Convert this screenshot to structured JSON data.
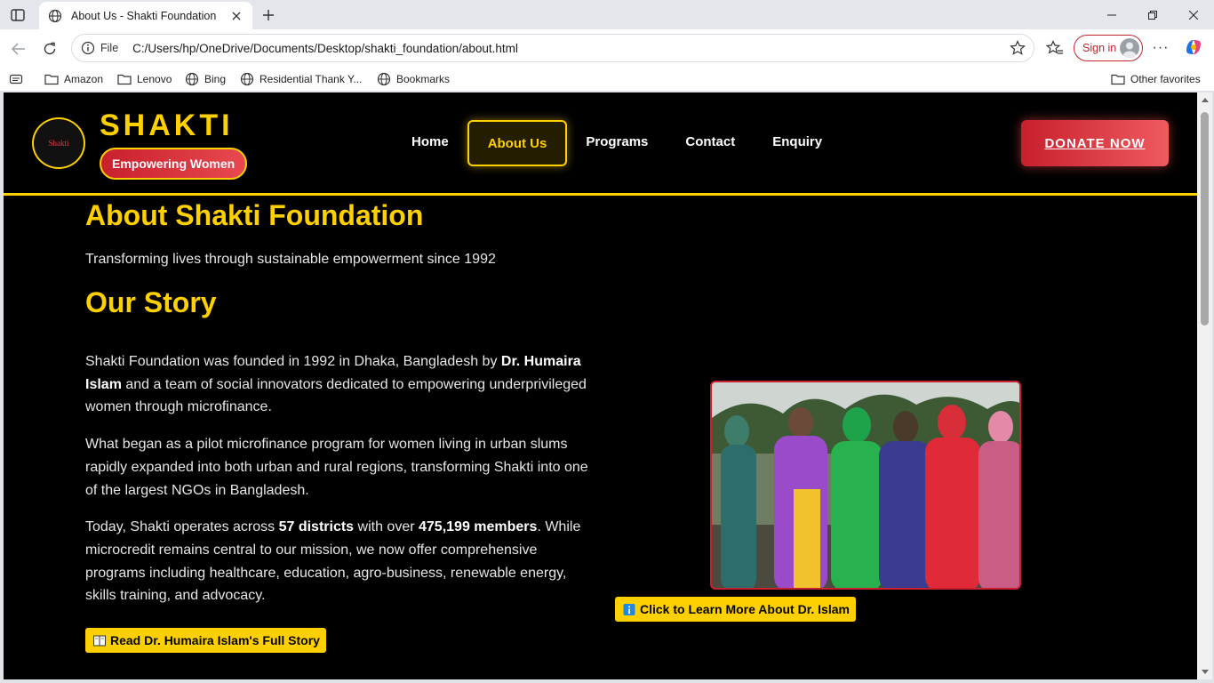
{
  "browser": {
    "tab_title": "About Us - Shakti Foundation",
    "address_scheme": "File",
    "address_url": "C:/Users/hp/OneDrive/Documents/Desktop/shakti_foundation/about.html",
    "signin_label": "Sign in",
    "bookmarks": [
      "Amazon",
      "Lenovo",
      "Bing",
      "Residential Thank Y...",
      "Bookmarks"
    ],
    "other_favorites": "Other favorites"
  },
  "site": {
    "brand": "SHAKTI",
    "logo_text": "Shakti",
    "tagline": "Empowering Women",
    "nav": [
      "Home",
      "About Us",
      "Programs",
      "Contact",
      "Enquiry"
    ],
    "active_nav": "About Us",
    "donate_label": "DONATE NOW"
  },
  "content": {
    "heading": "About Shakti Foundation",
    "subtitle": "Transforming lives through sustainable empowerment since 1992",
    "story_heading": "Our Story",
    "p1_a": "Shakti Foundation was founded in 1992 in Dhaka, Bangladesh by ",
    "p1_b": "Dr. Humaira Islam",
    "p1_c": " and a team of social innovators dedicated to empowering underprivileged women through microfinance.",
    "p2": "What began as a pilot microfinance program for women living in urban slums rapidly expanded into both urban and rural regions, transforming Shakti into one of the largest NGOs in Bangladesh.",
    "p3_a": "Today, Shakti operates across ",
    "p3_b": "57 districts",
    "p3_c": " with over ",
    "p3_d": "475,199 members",
    "p3_e": ". While microcredit remains central to our mission, we now offer comprehensive programs including healthcare, education, agro-business, renewable energy, skills training, and advocacy.",
    "read_story_button": "Read Dr. Humaira Islam's Full Story",
    "learn_more_button": "Click to Learn More About Dr. Islam"
  },
  "colors": {
    "accent": "#ffd000",
    "brand_red": "#c8202d",
    "page_bg": "#000000"
  }
}
